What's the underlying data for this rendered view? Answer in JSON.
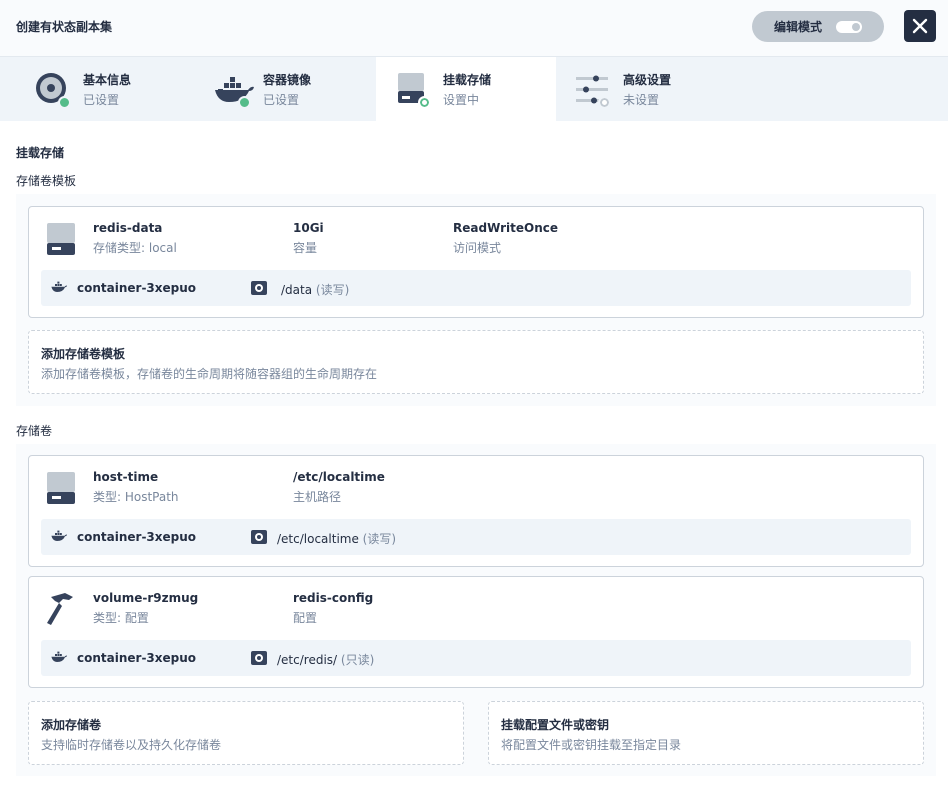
{
  "header": {
    "title": "创建有状态副本集",
    "edit_mode_label": "编辑模式"
  },
  "steps": [
    {
      "title": "基本信息",
      "status": "已设置"
    },
    {
      "title": "容器镜像",
      "status": "已设置"
    },
    {
      "title": "挂载存储",
      "status": "设置中"
    },
    {
      "title": "高级设置",
      "status": "未设置"
    }
  ],
  "main": {
    "title": "挂载存储",
    "templates_label": "存储卷模板",
    "volumes_label": "存储卷"
  },
  "templates": [
    {
      "name": "redis-data",
      "type_text": "存储类型: local",
      "capacity": "10Gi",
      "capacity_label": "容量",
      "access_mode": "ReadWriteOnce",
      "access_mode_label": "访问模式",
      "mount": {
        "container": "container-3xepuo",
        "path": "/data",
        "mode": "(读写)"
      }
    }
  ],
  "add_template": {
    "title": "添加存储卷模板",
    "desc": "添加存储卷模板，存储卷的生命周期将随容器组的生命周期存在"
  },
  "volumes": [
    {
      "name": "host-time",
      "type_text": "类型: HostPath",
      "value": "/etc/localtime",
      "value_label": "主机路径",
      "icon": "disk-icon",
      "mount": {
        "container": "container-3xepuo",
        "path": "/etc/localtime",
        "mode": "(读写)"
      }
    },
    {
      "name": "volume-r9zmug",
      "type_text": "类型: 配置",
      "value": "redis-config",
      "value_label": "配置",
      "icon": "hammer-icon",
      "mount": {
        "container": "container-3xepuo",
        "path": "/etc/redis/",
        "mode": "(只读)"
      }
    }
  ],
  "add_volume": {
    "title": "添加存储卷",
    "desc": "支持临时存储卷以及持久化存储卷"
  },
  "mount_config": {
    "title": "挂载配置文件或密钥",
    "desc": "将配置文件或密钥挂载至指定目录"
  }
}
